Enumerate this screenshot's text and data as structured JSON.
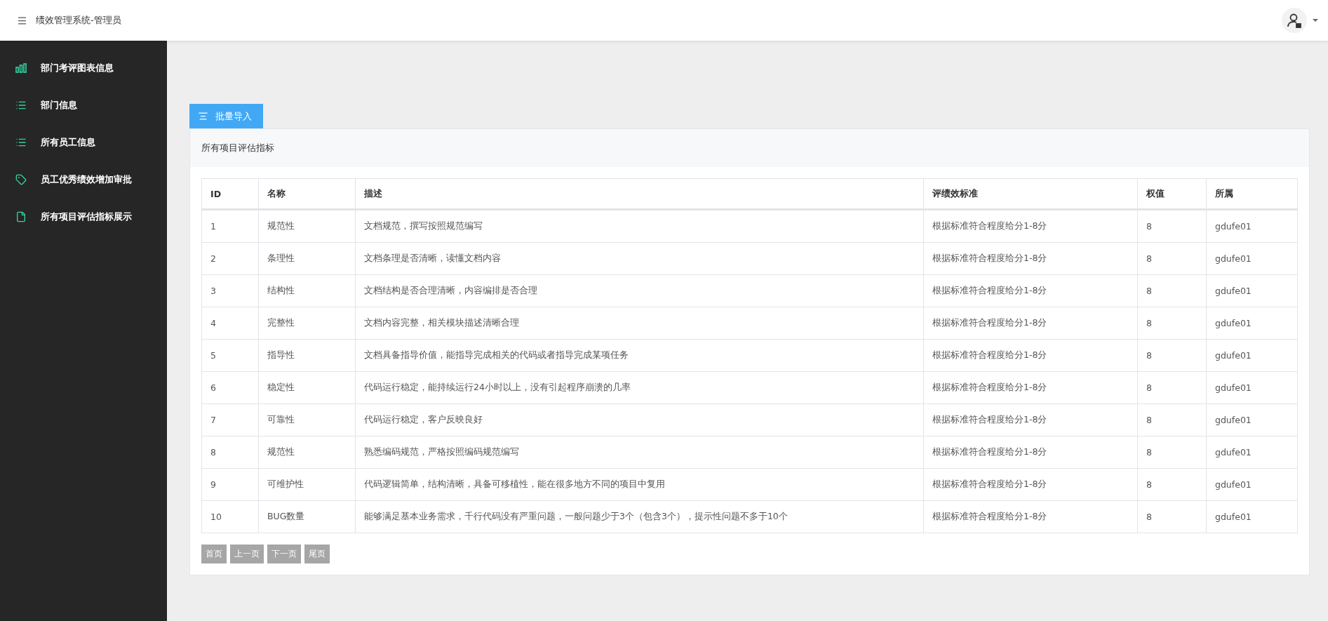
{
  "header": {
    "title": "绩效管理系统-管理员"
  },
  "sidebar": {
    "items": [
      {
        "label": "部门考评图表信息"
      },
      {
        "label": "部门信息"
      },
      {
        "label": "所有员工信息"
      },
      {
        "label": "员工优秀绩效增加审批"
      },
      {
        "label": "所有项目评估指标展示"
      }
    ]
  },
  "import_button": "批量导入",
  "panel": {
    "title": "所有项目评估指标"
  },
  "table": {
    "columns": [
      "ID",
      "名称",
      "描述",
      "评绩效标准",
      "权值",
      "所属"
    ],
    "rows": [
      [
        "1",
        "规范性",
        "文档规范，撰写按照规范编写",
        "根据标准符合程度给分1-8分",
        "8",
        "gdufe01"
      ],
      [
        "2",
        "条理性",
        "文档条理是否清晰，读懂文档内容",
        "根据标准符合程度给分1-8分",
        "8",
        "gdufe01"
      ],
      [
        "3",
        "结构性",
        "文档结构是否合理清晰，内容编排是否合理",
        "根据标准符合程度给分1-8分",
        "8",
        "gdufe01"
      ],
      [
        "4",
        "完整性",
        "文档内容完整，相关模块描述清晰合理",
        "根据标准符合程度给分1-8分",
        "8",
        "gdufe01"
      ],
      [
        "5",
        "指导性",
        "文档具备指导价值，能指导完成相关的代码或者指导完成某项任务",
        "根据标准符合程度给分1-8分",
        "8",
        "gdufe01"
      ],
      [
        "6",
        "稳定性",
        "代码运行稳定，能持续运行24小时以上，没有引起程序崩溃的几率",
        "根据标准符合程度给分1-8分",
        "8",
        "gdufe01"
      ],
      [
        "7",
        "可靠性",
        "代码运行稳定，客户反映良好",
        "根据标准符合程度给分1-8分",
        "8",
        "gdufe01"
      ],
      [
        "8",
        "规范性",
        "熟悉编码规范，严格按照编码规范编写",
        "根据标准符合程度给分1-8分",
        "8",
        "gdufe01"
      ],
      [
        "9",
        "可维护性",
        "代码逻辑简单，结构清晰，具备可移植性，能在很多地方不同的项目中复用",
        "根据标准符合程度给分1-8分",
        "8",
        "gdufe01"
      ],
      [
        "10",
        "BUG数量",
        "能够满足基本业务需求，千行代码没有严重问题，一般问题少于3个（包含3个），提示性问题不多于10个",
        "根据标准符合程度给分1-8分",
        "8",
        "gdufe01"
      ]
    ]
  },
  "pagination": [
    "首页",
    "上一页",
    "下一页",
    "尾页"
  ]
}
